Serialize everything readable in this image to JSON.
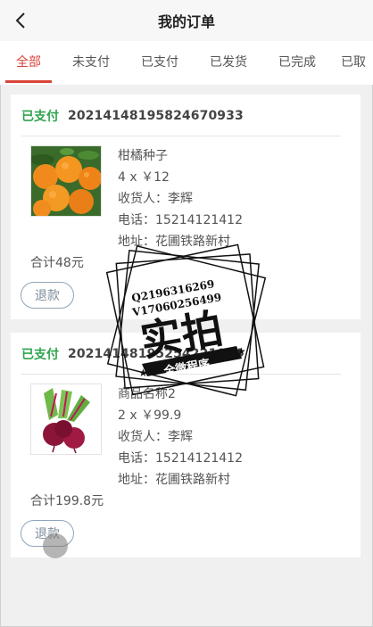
{
  "header": {
    "title": "我的订单",
    "back_icon": "chevron-left-icon"
  },
  "tabs": [
    {
      "label": "全部",
      "active": true
    },
    {
      "label": "未支付",
      "active": false
    },
    {
      "label": "已支付",
      "active": false
    },
    {
      "label": "已发货",
      "active": false
    },
    {
      "label": "已完成",
      "active": false
    },
    {
      "label": "已取",
      "active": false
    }
  ],
  "orders": [
    {
      "status": "已支付",
      "order_no": "20214148195824670933",
      "product_name": "柑橘种子",
      "qty_price": "4 x ￥12",
      "receiver": "收货人：李辉",
      "phone": "电话：15214121412",
      "address": "地址：花圃铁路新村",
      "total": "合计48元",
      "refund_label": "退款",
      "image": "oranges"
    },
    {
      "status": "已支付",
      "order_no": "20214148195254221084",
      "product_name": "商品名称2",
      "qty_price": "2 x ￥99.9",
      "receiver": "收货人：李辉",
      "phone": "电话：15214121412",
      "address": "地址：花圃铁路新村",
      "total": "合计199.8元",
      "refund_label": "退款",
      "image": "beetroot"
    }
  ],
  "watermark": {
    "qq": "Q2196316269",
    "vx": "V17060256499",
    "big": "实拍",
    "ribbon": "全微程序"
  },
  "colors": {
    "accent": "#d9453a",
    "paid": "#2ea44f"
  }
}
